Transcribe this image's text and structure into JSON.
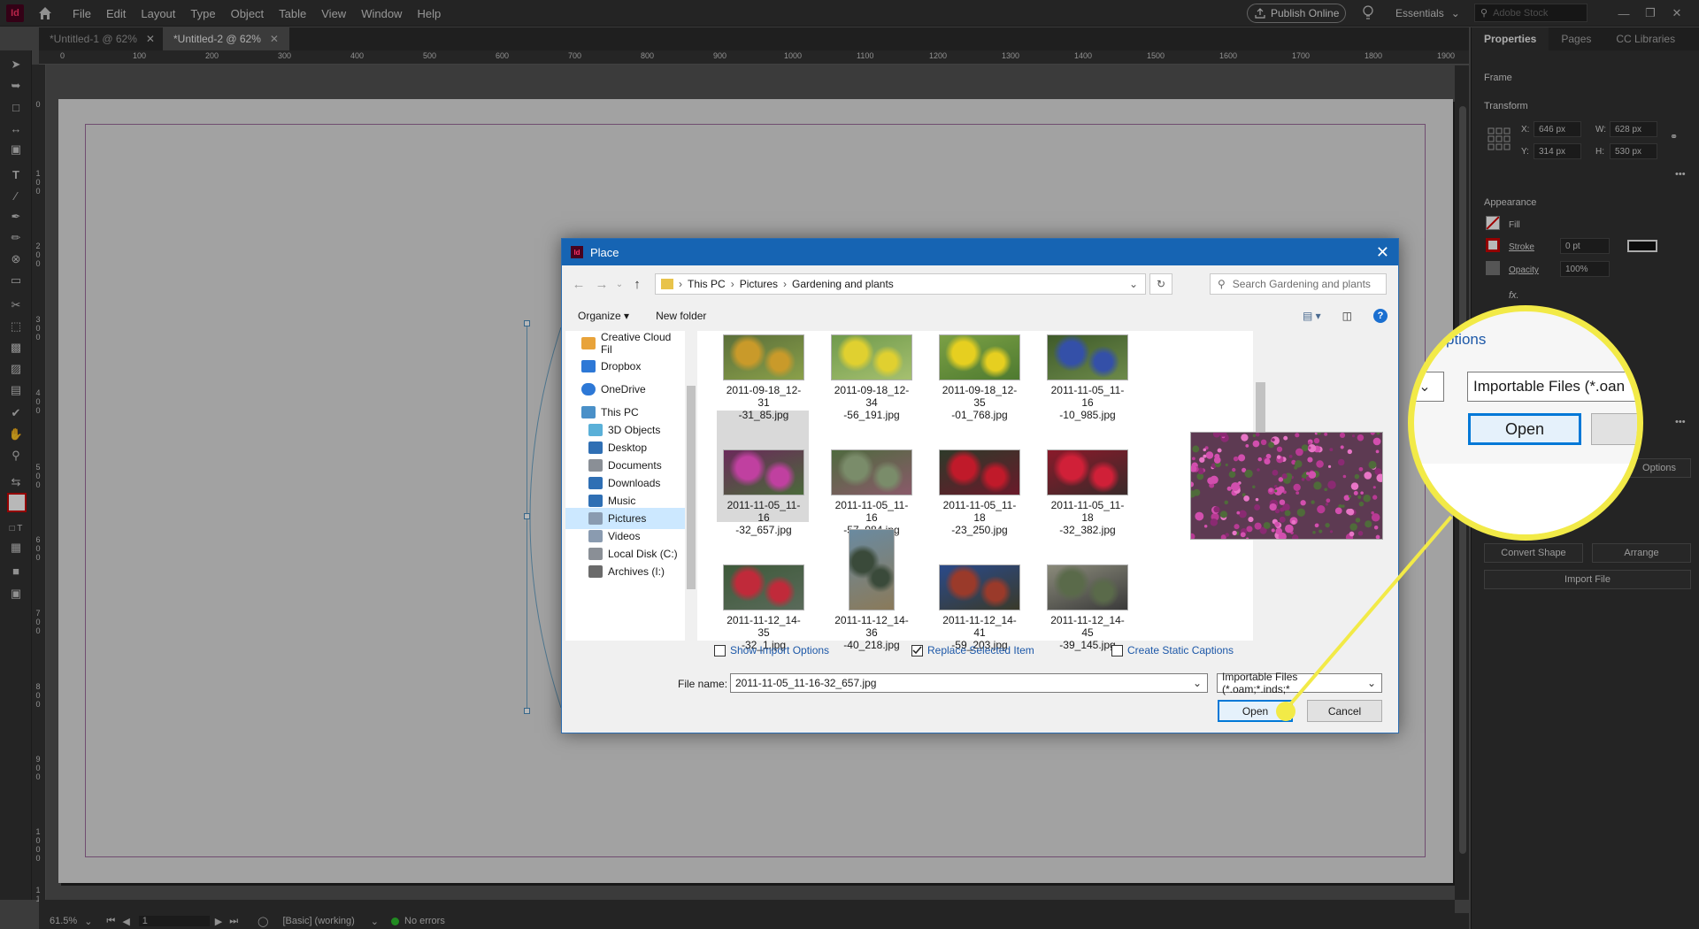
{
  "app": {
    "logo": "Id",
    "menu": [
      "File",
      "Edit",
      "Layout",
      "Type",
      "Object",
      "Table",
      "View",
      "Window",
      "Help"
    ],
    "publish_label": "Publish Online",
    "workspace_label": "Essentials",
    "stock_placeholder": "Adobe Stock",
    "tabs": [
      {
        "label": "*Untitled-1 @ 62%",
        "active": false
      },
      {
        "label": "*Untitled-2 @ 62%",
        "active": true
      }
    ]
  },
  "ruler": {
    "h_ticks": [
      "0",
      "100",
      "200",
      "300",
      "400",
      "500",
      "600",
      "700",
      "800",
      "900",
      "1000",
      "1100",
      "1200",
      "1300",
      "1400",
      "1500",
      "1600",
      "1700",
      "1800",
      "1900"
    ],
    "v_ticks": [
      "0",
      "1 0 0",
      "2 0 0",
      "3 0 0",
      "4 0 0",
      "5 0 0",
      "6 0 0",
      "7 0 0",
      "8 0 0",
      "9 0 0",
      "1 0 0 0",
      "1 1"
    ]
  },
  "status": {
    "zoom": "61.5%",
    "page": "1",
    "style": "[Basic] (working)",
    "errors": "No errors"
  },
  "properties": {
    "tabs": [
      "Properties",
      "Pages",
      "CC Libraries"
    ],
    "frame_label": "Frame",
    "transform_label": "Transform",
    "x_label": "X:",
    "x_value": "646 px",
    "y_label": "Y:",
    "y_value": "314 px",
    "w_label": "W:",
    "w_value": "628 px",
    "h_label": "H:",
    "h_value": "530 px",
    "appearance_label": "Appearance",
    "fill_label": "Fill",
    "stroke_label": "Stroke",
    "stroke_value": "0 pt",
    "opacity_label": "Opacity",
    "opacity_value": "100%",
    "fx_label": "fx.",
    "options_label": "Options",
    "convert_shape_label": "Convert Shape",
    "arrange_label": "Arrange",
    "import_file_label": "Import File"
  },
  "dialog": {
    "title": "Place",
    "breadcrumb": [
      "This PC",
      "Pictures",
      "Gardening and plants"
    ],
    "search_placeholder": "Search Gardening and plants",
    "organize_label": "Organize",
    "new_folder_label": "New folder",
    "nav_items": [
      {
        "label": "Creative Cloud Fil",
        "icon": "creative-cloud-icon",
        "color": "#e8a33a"
      },
      {
        "label": "Dropbox",
        "icon": "dropbox-icon",
        "color": "#2d78d6"
      },
      {
        "label": "OneDrive",
        "icon": "onedrive-icon",
        "color": "#2d78d6"
      },
      {
        "label": "This PC",
        "icon": "computer-icon",
        "color": "#4a90c8"
      },
      {
        "label": "3D Objects",
        "icon": "cube-icon",
        "color": "#5ab0d8"
      },
      {
        "label": "Desktop",
        "icon": "desktop-icon",
        "color": "#2f6fb4"
      },
      {
        "label": "Documents",
        "icon": "document-icon",
        "color": "#8a8f96"
      },
      {
        "label": "Downloads",
        "icon": "download-icon",
        "color": "#2f6fb4"
      },
      {
        "label": "Music",
        "icon": "music-icon",
        "color": "#2f6fb4"
      },
      {
        "label": "Pictures",
        "icon": "pictures-icon",
        "color": "#8a9bb0"
      },
      {
        "label": "Videos",
        "icon": "video-icon",
        "color": "#8a9bb0"
      },
      {
        "label": "Local Disk (C:)",
        "icon": "drive-icon",
        "color": "#8a8f96"
      },
      {
        "label": "Archives (I:)",
        "icon": "drive-icon",
        "color": "#6b6b6b"
      }
    ],
    "files": [
      {
        "line1": "2011-09-18_12-31",
        "line2": "-31_85.jpg",
        "colors": [
          "#5b6f3a",
          "#c99a2a",
          "#8aa04a"
        ]
      },
      {
        "line1": "2011-09-18_12-34",
        "line2": "-56_191.jpg",
        "colors": [
          "#6f9a4c",
          "#e0d030",
          "#a6c070"
        ]
      },
      {
        "line1": "2011-09-18_12-35",
        "line2": "-01_768.jpg",
        "colors": [
          "#7ba045",
          "#e6cf20",
          "#4e7a30"
        ]
      },
      {
        "line1": "2011-11-05_11-16",
        "line2": "-10_985.jpg",
        "colors": [
          "#3e5a2a",
          "#3450a8",
          "#6d8a4a"
        ]
      },
      {
        "line1": "2011-11-05_11-16",
        "line2": "-32_657.jpg",
        "colors": [
          "#6a2a5a",
          "#c040a0",
          "#4a6a3a"
        ]
      },
      {
        "line1": "2011-11-05_11-16",
        "line2": "-57_984.jpg",
        "colors": [
          "#4f6a3f",
          "#7a8c6a",
          "#8a5a6a"
        ]
      },
      {
        "line1": "2011-11-05_11-18",
        "line2": "-23_250.jpg",
        "colors": [
          "#2e3a2a",
          "#c01a2a",
          "#6a1a2a"
        ]
      },
      {
        "line1": "2011-11-05_11-18",
        "line2": "-32_382.jpg",
        "colors": [
          "#8a1a2a",
          "#d02038",
          "#3a2a2a"
        ]
      },
      {
        "line1": "2011-11-12_14-35",
        "line2": "-32_1.jpg",
        "colors": [
          "#3e5a3a",
          "#c02a3a",
          "#5a6a5a"
        ]
      },
      {
        "line1": "2011-11-12_14-36",
        "line2": "-40_218.jpg",
        "colors": [
          "#6a8aa0",
          "#3a4a3a",
          "#8a7a5a"
        ]
      },
      {
        "line1": "2011-11-12_14-41",
        "line2": "-59_203.jpg",
        "colors": [
          "#2a4a8a",
          "#9a3a2a",
          "#3a3a2a"
        ]
      },
      {
        "line1": "2011-11-12_14-45",
        "line2": "-39_145.jpg",
        "colors": [
          "#8a8a7a",
          "#5a6a4a",
          "#3a3a3a"
        ]
      }
    ],
    "show_import_options": "Show Import Options",
    "replace_selected_item": "Replace Selected Item",
    "create_static_captions": "Create Static Captions",
    "file_name_label": "File name:",
    "file_name_value": "2011-11-05_11-16-32_657.jpg",
    "file_type_value": "Importable Files (*.oam;*.inds;*",
    "open_label": "Open",
    "cancel_label": "Cancel"
  },
  "magnifier": {
    "options_text": "ptions",
    "file_type_text": "Importable Files (*.oan",
    "open_label": "Open"
  }
}
